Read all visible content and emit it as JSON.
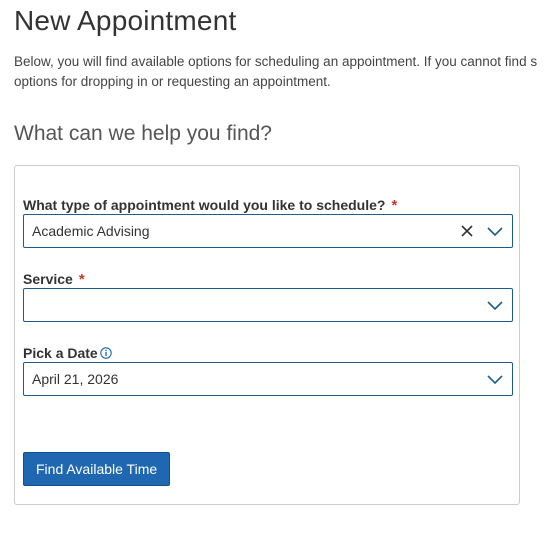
{
  "page": {
    "title": "New Appointment",
    "intro_line1": "Below, you will find available options for scheduling an appointment. If you cannot find s",
    "intro_line2": "options for dropping in or requesting an appointment.",
    "section_heading": "What can we help you find?"
  },
  "form": {
    "appointment_type": {
      "label": "What type of appointment would you like to schedule?",
      "required_mark": "*",
      "value": "Academic Advising"
    },
    "service": {
      "label": "Service",
      "required_mark": "*",
      "value": ""
    },
    "date": {
      "label": "Pick a Date",
      "value": "April 21, 2026"
    },
    "submit_label": "Find Available Time"
  },
  "icons": {
    "clear": "close-icon",
    "dropdown": "chevron-down-icon",
    "info": "info-icon"
  },
  "colors": {
    "accent": "#1f67b1",
    "field_border": "#1c5c8e",
    "required": "#c0392b",
    "card_border": "#cccccc"
  }
}
